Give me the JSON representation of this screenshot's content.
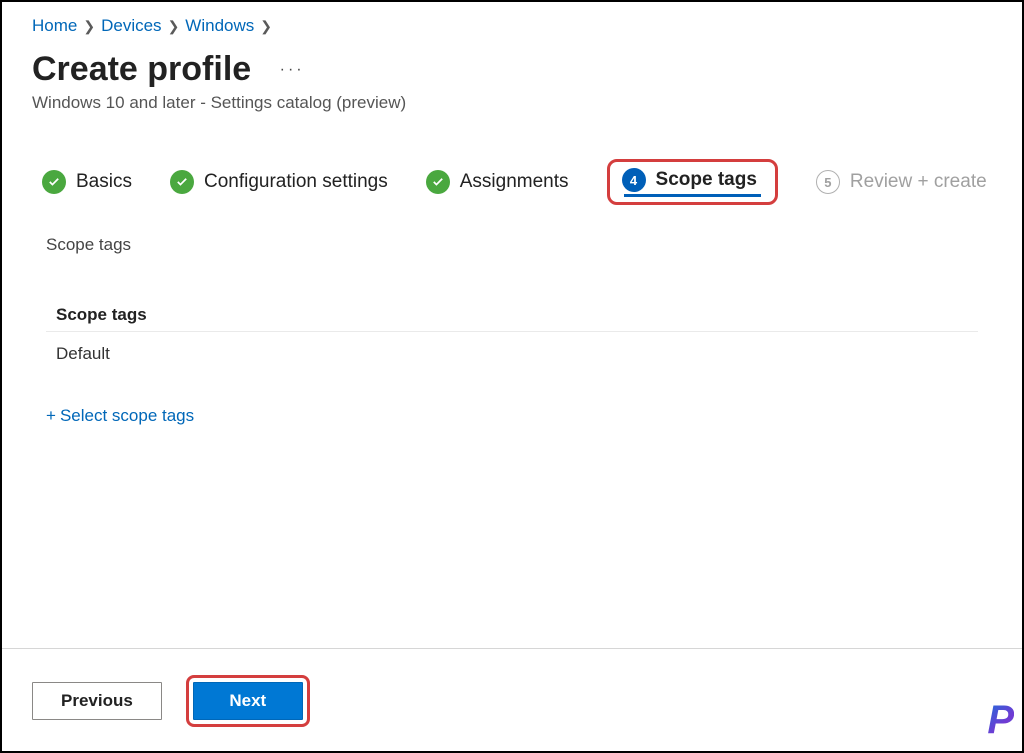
{
  "breadcrumb": {
    "home": "Home",
    "devices": "Devices",
    "windows": "Windows"
  },
  "header": {
    "title": "Create profile",
    "subtitle": "Windows 10 and later - Settings catalog (preview)",
    "more_label": "···"
  },
  "tabs": {
    "basics": "Basics",
    "config": "Configuration settings",
    "assignments": "Assignments",
    "scope_tags": "Scope tags",
    "review": "Review + create",
    "step4_num": "4",
    "step5_num": "5"
  },
  "content": {
    "section_label": "Scope tags",
    "column_header": "Scope tags",
    "row_value": "Default",
    "add_link": "Select scope tags"
  },
  "footer": {
    "previous": "Previous",
    "next": "Next"
  },
  "watermark": "P",
  "colors": {
    "accent": "#0078d4",
    "link": "#0067b8",
    "success": "#4aa83f",
    "highlight_border": "#d43e3e"
  }
}
